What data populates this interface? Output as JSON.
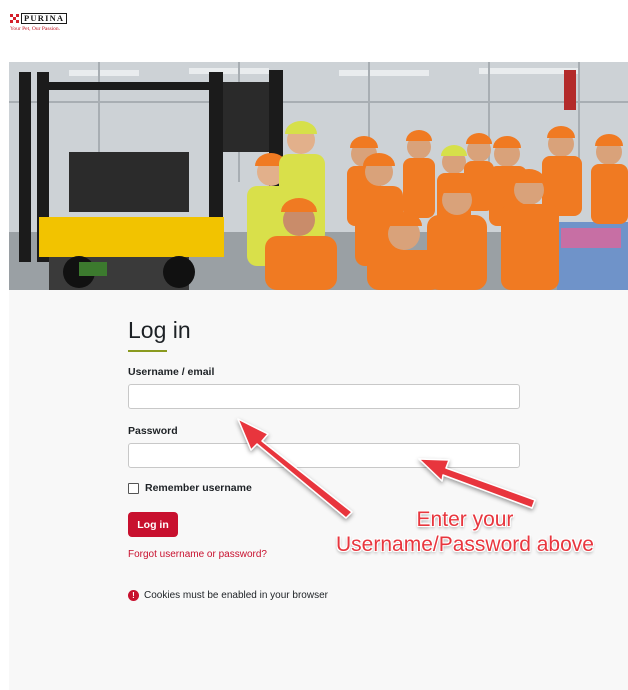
{
  "brand": {
    "logo_word": "PURINA",
    "tagline": "Your Pet, Our Passion."
  },
  "login": {
    "title": "Log in",
    "username_label": "Username / email",
    "username_value": "",
    "password_label": "Password",
    "password_value": "",
    "remember_label": "Remember username",
    "remember_checked": false,
    "submit_label": "Log in",
    "forgot_link": "Forgot username or password?",
    "cookie_notice": "Cookies must be enabled in your browser"
  },
  "annotation": {
    "line1": "Enter your",
    "line2": "Username/Password above"
  },
  "colors": {
    "accent": "#c8102e",
    "title_underline": "#8a9a1f",
    "annotation": "#e8363e",
    "vest_orange": "#f07a22"
  }
}
